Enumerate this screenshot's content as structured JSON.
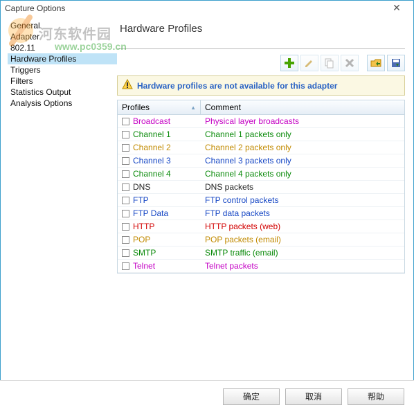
{
  "window": {
    "title": "Capture Options"
  },
  "watermark": {
    "text1": "河东软件园",
    "text2": "www.pc0359.cn"
  },
  "sidebar": {
    "items": [
      {
        "label": "General"
      },
      {
        "label": "Adapter"
      },
      {
        "label": "802.11"
      },
      {
        "label": "Hardware Profiles",
        "selected": true
      },
      {
        "label": "Triggers"
      },
      {
        "label": "Filters"
      },
      {
        "label": "Statistics Output"
      },
      {
        "label": "Analysis Options"
      }
    ]
  },
  "content": {
    "heading": "Hardware Profiles",
    "warning": "Hardware profiles are not available for this adapter",
    "columns": {
      "profiles": "Profiles",
      "comment": "Comment"
    },
    "rows": [
      {
        "name": "Broadcast",
        "nameColor": "#c400c4",
        "comment": "Physical layer broadcasts",
        "commentColor": "#c400c4"
      },
      {
        "name": "Channel 1",
        "nameColor": "#0a8a0a",
        "comment": "Channel 1 packets only",
        "commentColor": "#0a8a0a"
      },
      {
        "name": "Channel 2",
        "nameColor": "#c18a00",
        "comment": "Channel 2 packets only",
        "commentColor": "#c18a00"
      },
      {
        "name": "Channel 3",
        "nameColor": "#1546c4",
        "comment": "Channel 3 packets only",
        "commentColor": "#1546c4"
      },
      {
        "name": "Channel 4",
        "nameColor": "#0a8a0a",
        "comment": "Channel 4 packets only",
        "commentColor": "#0a8a0a"
      },
      {
        "name": "DNS",
        "nameColor": "#222",
        "comment": "DNS packets",
        "commentColor": "#222"
      },
      {
        "name": "FTP",
        "nameColor": "#1546c4",
        "comment": "FTP control packets",
        "commentColor": "#1546c4"
      },
      {
        "name": "FTP Data",
        "nameColor": "#1546c4",
        "comment": "FTP data packets",
        "commentColor": "#1546c4"
      },
      {
        "name": "HTTP",
        "nameColor": "#d20000",
        "comment": "HTTP packets (web)",
        "commentColor": "#d20000"
      },
      {
        "name": "POP",
        "nameColor": "#c18a00",
        "comment": "POP packets (email)",
        "commentColor": "#c18a00"
      },
      {
        "name": "SMTP",
        "nameColor": "#0a8a0a",
        "comment": "SMTP traffic (email)",
        "commentColor": "#0a8a0a"
      },
      {
        "name": "Telnet",
        "nameColor": "#c400c4",
        "comment": "Telnet packets",
        "commentColor": "#c400c4"
      }
    ]
  },
  "buttons": {
    "ok": "确定",
    "cancel": "取消",
    "help": "帮助"
  }
}
